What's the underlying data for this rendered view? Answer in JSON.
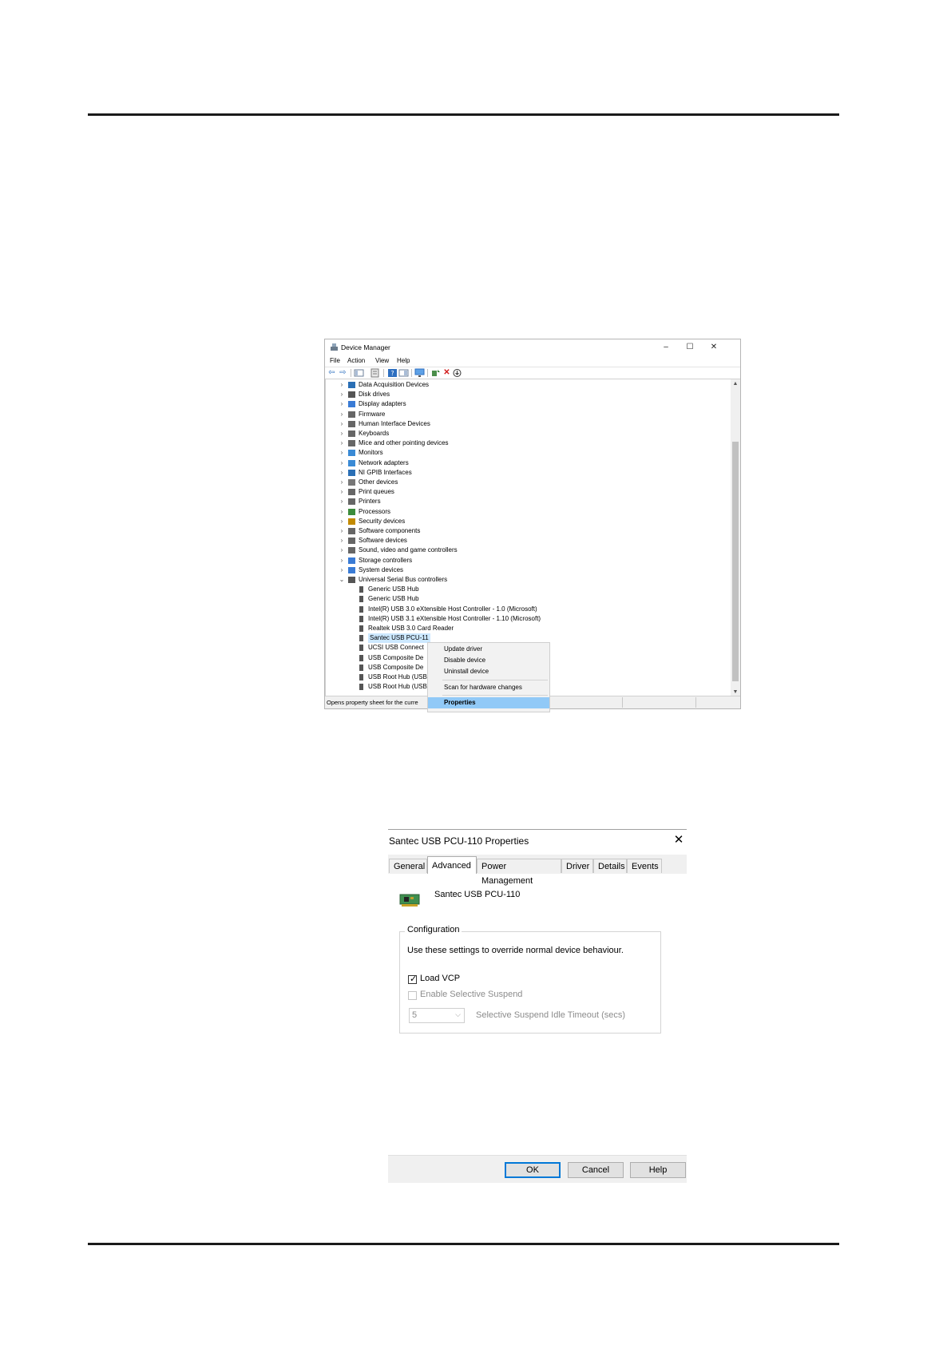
{
  "device_manager": {
    "title": "Device Manager",
    "window_controls": {
      "minimize": "–",
      "maximize": "☐",
      "close": "✕"
    },
    "menu": [
      "File",
      "Action",
      "View",
      "Help"
    ],
    "tree": [
      {
        "label": "Data Acquisition Devices",
        "icon": "daq-icon",
        "color": "#2a6fb5"
      },
      {
        "label": "Disk drives",
        "icon": "disk-drive-icon",
        "color": "#555555"
      },
      {
        "label": "Display adapters",
        "icon": "display-adapter-icon",
        "color": "#3a7bd5"
      },
      {
        "label": "Firmware",
        "icon": "firmware-icon",
        "color": "#666666"
      },
      {
        "label": "Human Interface Devices",
        "icon": "hid-icon",
        "color": "#666666"
      },
      {
        "label": "Keyboards",
        "icon": "keyboard-icon",
        "color": "#666666"
      },
      {
        "label": "Mice and other pointing devices",
        "icon": "mouse-icon",
        "color": "#666666"
      },
      {
        "label": "Monitors",
        "icon": "monitor-icon",
        "color": "#3a8ad5"
      },
      {
        "label": "Network adapters",
        "icon": "network-adapter-icon",
        "color": "#3a8ad5"
      },
      {
        "label": "NI GPIB Interfaces",
        "icon": "gpib-icon",
        "color": "#2a6fb5"
      },
      {
        "label": "Other devices",
        "icon": "other-devices-icon",
        "color": "#777777"
      },
      {
        "label": "Print queues",
        "icon": "print-queue-icon",
        "color": "#666666"
      },
      {
        "label": "Printers",
        "icon": "printer-icon",
        "color": "#666666"
      },
      {
        "label": "Processors",
        "icon": "processor-icon",
        "color": "#3c8c3c"
      },
      {
        "label": "Security devices",
        "icon": "security-device-icon",
        "color": "#c28a00"
      },
      {
        "label": "Software components",
        "icon": "software-component-icon",
        "color": "#666666"
      },
      {
        "label": "Software devices",
        "icon": "software-device-icon",
        "color": "#666666"
      },
      {
        "label": "Sound, video and game controllers",
        "icon": "speaker-icon",
        "color": "#666666"
      },
      {
        "label": "Storage controllers",
        "icon": "storage-controller-icon",
        "color": "#3a7bd5"
      },
      {
        "label": "System devices",
        "icon": "system-device-icon",
        "color": "#3a7bd5"
      },
      {
        "label": "Universal Serial Bus controllers",
        "icon": "usb-icon",
        "color": "#555555",
        "expanded": true
      }
    ],
    "usb_children": [
      "Generic USB Hub",
      "Generic USB Hub",
      "Intel(R) USB 3.0 eXtensible Host Controller - 1.0 (Microsoft)",
      "Intel(R) USB 3.1 eXtensible Host Controller - 1.10 (Microsoft)",
      "Realtek USB 3.0 Card Reader",
      "Santec USB PCU-11",
      "UCSI USB Connect",
      "USB Composite De",
      "USB Composite De",
      "USB Root Hub (USB",
      "USB Root Hub (USB"
    ],
    "selected_child_index": 5,
    "status_text": "Opens property sheet for the curre",
    "context_menu": {
      "items": [
        "Update driver",
        "Disable device",
        "Uninstall device",
        "Scan for hardware changes",
        "Properties"
      ],
      "highlighted": "Properties"
    }
  },
  "properties_dialog": {
    "title": "Santec USB PCU-110 Properties",
    "close_glyph": "✕",
    "tabs": [
      "General",
      "Advanced",
      "Power Management",
      "Driver",
      "Details",
      "Events"
    ],
    "active_tab": "Advanced",
    "device_name": "Santec USB PCU-110",
    "group_title": "Configuration",
    "description": "Use these settings to override normal device behaviour.",
    "load_vcp": {
      "label": "Load VCP",
      "checked": true
    },
    "selective_suspend": {
      "label": "Enable Selective Suspend",
      "checked": false,
      "enabled": false
    },
    "timeout": {
      "value": "5",
      "label": "Selective Suspend Idle Timeout (secs)"
    },
    "buttons": {
      "ok": "OK",
      "cancel": "Cancel",
      "help": "Help"
    },
    "accent_color": "#0078d7"
  }
}
